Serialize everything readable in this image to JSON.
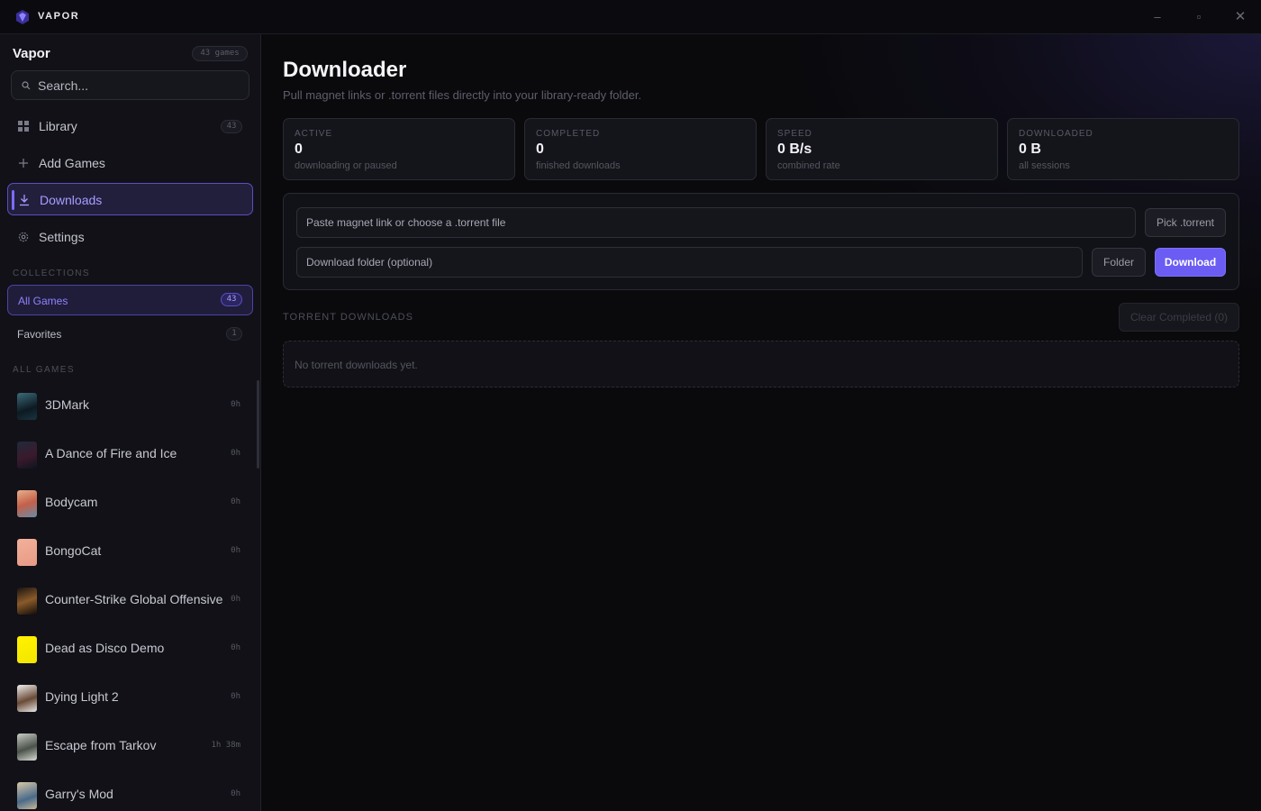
{
  "window": {
    "app_name": "VAPOR",
    "minimize_glyph": "–",
    "maximize_glyph": "▫",
    "close_glyph": "✕"
  },
  "sidebar": {
    "title": "Vapor",
    "game_count": "43 games",
    "search_placeholder": "Search...",
    "nav": [
      {
        "label": "Library",
        "icon": "grid-icon",
        "count": "43"
      },
      {
        "label": "Add Games",
        "icon": "plus-icon"
      },
      {
        "label": "Downloads",
        "icon": "download-icon",
        "active": true
      },
      {
        "label": "Settings",
        "icon": "gear-icon"
      }
    ],
    "collections_header": "COLLECTIONS",
    "collections": [
      {
        "label": "All Games",
        "count": "43",
        "active": true
      },
      {
        "label": "Favorites",
        "count": "1"
      }
    ],
    "all_games_header": "ALL GAMES",
    "games": [
      {
        "name": "3DMark",
        "time": "0h"
      },
      {
        "name": "A Dance of Fire and Ice",
        "time": "0h"
      },
      {
        "name": "Bodycam",
        "time": "0h"
      },
      {
        "name": "BongoCat",
        "time": "0h"
      },
      {
        "name": "Counter-Strike Global Offensive",
        "time": "0h"
      },
      {
        "name": "Dead as Disco Demo",
        "time": "0h"
      },
      {
        "name": "Dying Light 2",
        "time": "0h"
      },
      {
        "name": "Escape from Tarkov",
        "time": "1h 38m"
      },
      {
        "name": "Garry's Mod",
        "time": "0h"
      }
    ]
  },
  "main": {
    "title": "Downloader",
    "subtitle": "Pull magnet links or .torrent files directly into your library-ready folder.",
    "stats": [
      {
        "label": "ACTIVE",
        "value": "0",
        "sub": "downloading or paused"
      },
      {
        "label": "COMPLETED",
        "value": "0",
        "sub": "finished downloads"
      },
      {
        "label": "SPEED",
        "value": "0 B/s",
        "sub": "combined rate"
      },
      {
        "label": "DOWNLOADED",
        "value": "0 B",
        "sub": "all sessions"
      }
    ],
    "magnet_placeholder": "Paste magnet link or choose a .torrent file",
    "folder_placeholder": "Download folder (optional)",
    "pick_label": "Pick .torrent",
    "folder_label": "Folder",
    "download_label": "Download",
    "torrent_header": "TORRENT DOWNLOADS",
    "clear_label": "Clear Completed (0)",
    "empty_text": "No torrent downloads yet."
  },
  "colors": {
    "accent": "#6b5cf3",
    "accent_text": "#a79dff",
    "background": "#0a0a0d",
    "sidebar": "#111117"
  }
}
